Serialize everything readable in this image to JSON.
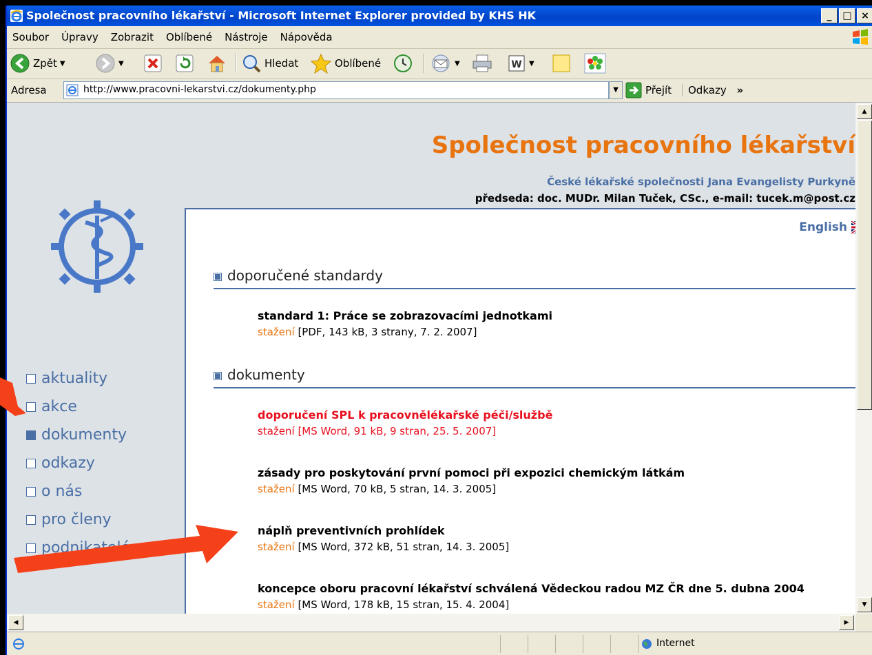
{
  "window": {
    "title": "Společnost pracovního lékařství - Microsoft Internet Explorer provided by KHS HK",
    "buttons": [
      "_",
      "□",
      "×"
    ]
  },
  "menu": [
    "Soubor",
    "Úpravy",
    "Zobrazit",
    "Oblíbené",
    "Nástroje",
    "Nápověda"
  ],
  "toolbar": {
    "back_label": "Zpět",
    "search_label": "Hledat",
    "favorites_label": "Oblíbené"
  },
  "address": {
    "label": "Adresa",
    "url": "http://www.pracovni-lekarstvi.cz/dokumenty.php",
    "go_label": "Přejít",
    "links_label": "Odkazy",
    "links_more": "»"
  },
  "site": {
    "title": "Společnost pracovního lékařství",
    "subtitle": "České lékařské společnosti Jana Evangelisty Purkyně",
    "chair": "předseda: doc. MUDr. Milan Tuček, CSc., e-mail: tucek.m@post.cz",
    "english": "English"
  },
  "nav": [
    {
      "label": "aktuality",
      "active": false
    },
    {
      "label": "akce",
      "active": false
    },
    {
      "label": "dokumenty",
      "active": true
    },
    {
      "label": "odkazy",
      "active": false
    },
    {
      "label": "o nás",
      "active": false
    },
    {
      "label": "pro členy",
      "active": false
    },
    {
      "label": "podnikatelé",
      "active": false
    }
  ],
  "sections": [
    {
      "heading": "doporučené standardy",
      "docs": [
        {
          "title": "standard 1: Práce se zobrazovacími jednotkami",
          "link": "stažení",
          "meta": "[PDF, 143 kB, 3 strany, 7. 2. 2007]",
          "red": false
        }
      ]
    },
    {
      "heading": "dokumenty",
      "docs": [
        {
          "title": "doporučení SPL k pracovnělékařské péči/službě",
          "link": "stažení",
          "meta": "[MS Word, 91 kB, 9 stran, 25. 5. 2007]",
          "red": true
        },
        {
          "title": "zásady pro poskytování první pomoci při expozici chemickým látkám",
          "link": "stažení",
          "meta": "[MS Word, 70 kB, 5 stran, 14. 3. 2005]",
          "red": false
        },
        {
          "title": "náplň preventivních prohlídek",
          "link": "stažení",
          "meta": "[MS Word, 372 kB, 51 stran, 14. 3. 2005]",
          "red": false
        },
        {
          "title": "koncepce oboru pracovní lékařství schválená Vědeckou radou MZ ČR dne 5. dubna 2004",
          "link": "stažení",
          "meta": "[MS Word, 178 kB, 15 stran, 15. 4. 2004]",
          "red": false
        }
      ]
    }
  ],
  "status": {
    "zone": "Internet"
  },
  "colors": {
    "accent_orange": "#E8740F",
    "nav_blue": "#4A6FA5",
    "highlight_red": "#E8101E",
    "annotation_arrow": "#F4411A"
  }
}
